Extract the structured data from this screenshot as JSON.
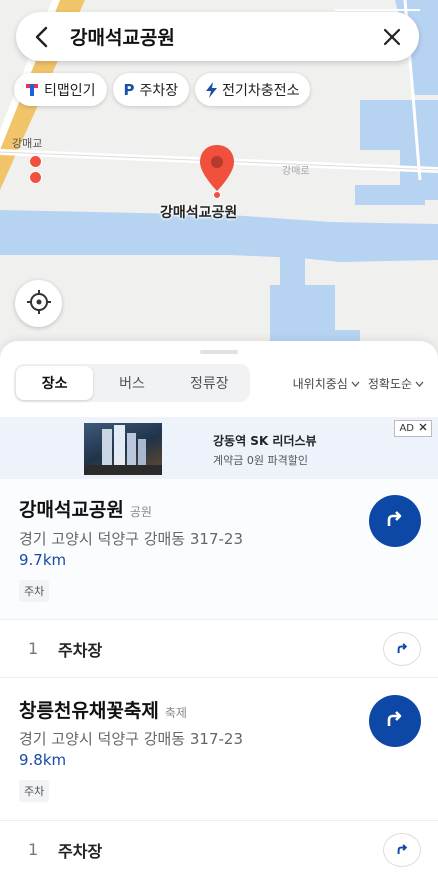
{
  "search": {
    "query": "강매석교공원"
  },
  "chips": [
    {
      "icon": "tmap-icon",
      "label": "티맵인기"
    },
    {
      "icon": "parking-icon",
      "label": "주차장",
      "icon_text": "P"
    },
    {
      "icon": "lightning-icon",
      "label": "전기차충전소"
    }
  ],
  "map": {
    "labels": {
      "place": "강매교",
      "road": "강매로",
      "pin_title": "강매석교공원"
    },
    "colors": {
      "land": "#f0f0ee",
      "water": "#b7d3f2",
      "road_main": "#f2c46a",
      "pin": "#f0503c"
    }
  },
  "tabs": {
    "items": [
      "장소",
      "버스",
      "정류장"
    ],
    "active": 0
  },
  "sort": {
    "distance": "내위치중심",
    "accuracy": "정확도순"
  },
  "ad": {
    "badge": "AD",
    "title": "강동역 SK 리더스뷰",
    "subtitle": "계약금 0원 파격할인"
  },
  "results": [
    {
      "name": "강매석교공원",
      "category": "공원",
      "address": "경기 고양시 덕양구 강매동 317-23",
      "distance": "9.7km",
      "tag": "주차",
      "sub": {
        "num": "1",
        "label": "주차장"
      }
    },
    {
      "name": "창릉천유채꽃축제",
      "category": "축제",
      "address": "경기 고양시 덕양구 강매동 317-23",
      "distance": "9.8km",
      "tag": "주차",
      "sub": {
        "num": "1",
        "label": "주차장"
      }
    }
  ],
  "colors": {
    "accent": "#0e48a6",
    "distance_text": "#1a49a8"
  }
}
